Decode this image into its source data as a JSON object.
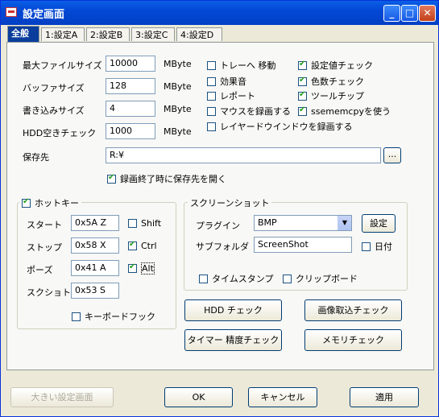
{
  "window": {
    "title": "設定画面"
  },
  "tabs": [
    "全般",
    "1:設定A",
    "2:設定B",
    "3:設定C",
    "4:設定D"
  ],
  "general": {
    "max_file_size": {
      "label": "最大ファイルサイズ",
      "value": "10000",
      "unit": "MByte"
    },
    "buffer_size": {
      "label": "バッファサイズ",
      "value": "128",
      "unit": "MByte"
    },
    "write_size": {
      "label": "書き込みサイズ",
      "value": "4",
      "unit": "MByte"
    },
    "hdd_free_check": {
      "label": "HDD空きチェック",
      "value": "1000",
      "unit": "MByte"
    },
    "save_dest": {
      "label": "保存先",
      "value": "R:¥",
      "browse": "..."
    },
    "open_dest_after_record": {
      "label": "録画終了時に保存先を開く",
      "checked": true
    }
  },
  "options_left": [
    {
      "label": "トレーへ 移動",
      "checked": false
    },
    {
      "label": "効果音",
      "checked": false
    },
    {
      "label": "レポート",
      "checked": false
    },
    {
      "label": "マウスを録画する",
      "checked": false
    },
    {
      "label": "レイヤードウインドウを録画する",
      "checked": false
    }
  ],
  "options_right": [
    {
      "label": "設定値チェック",
      "checked": true
    },
    {
      "label": "色数チェック",
      "checked": true
    },
    {
      "label": "ツールチップ",
      "checked": true
    },
    {
      "label": "ssememcpyを使う",
      "checked": true
    }
  ],
  "hotkey": {
    "label": "ホットキー",
    "enabled": true,
    "rows": [
      {
        "label": "スタート",
        "value": "0x5A Z",
        "mod": "Shift",
        "checked": false
      },
      {
        "label": "ストップ",
        "value": "0x58 X",
        "mod": "Ctrl",
        "checked": true
      },
      {
        "label": "ポーズ",
        "value": "0x41 A",
        "mod": "Alt",
        "checked": true
      },
      {
        "label": "スクショト",
        "value": "0x53 S"
      }
    ],
    "keyboard_hook": {
      "label": "キーボードフック",
      "checked": false
    }
  },
  "screenshot": {
    "label": "スクリーンショット",
    "plugin_label": "プラグイン",
    "plugin_value": "BMP",
    "settings_button": "設定",
    "subfolder_label": "サブフォルダ",
    "subfolder_value": "ScreenShot",
    "date": {
      "label": "日付",
      "checked": false
    },
    "timestamp": {
      "label": "タイムスタンプ",
      "checked": false
    },
    "clipboard": {
      "label": "クリップボード",
      "checked": false
    }
  },
  "check_buttons": {
    "hdd_check": "HDD チェック",
    "image_capture_check": "画像取込チェック",
    "timer_precision_check": "タイマー 精度チェック",
    "memory_check": "メモリチェック"
  },
  "footer": {
    "large_settings": "大きい設定画面",
    "ok": "OK",
    "cancel": "キャンセル",
    "apply": "適用"
  }
}
